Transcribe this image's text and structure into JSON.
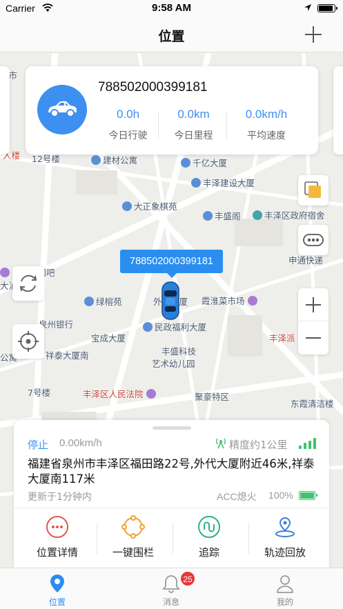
{
  "status_bar": {
    "carrier": "Carrier",
    "time": "9:58 AM"
  },
  "nav": {
    "title": "位置"
  },
  "vehicle": {
    "device_id": "788502000399181",
    "marker_label": "788502000399181",
    "stats": [
      {
        "value": "0.0h",
        "label": "今日行驶"
      },
      {
        "value": "0.0km",
        "label": "今日里程"
      },
      {
        "value": "0.0km/h",
        "label": "平均速度"
      }
    ]
  },
  "map_labels": [
    "人楼",
    "12号楼",
    "建材公寓",
    "千亿大厦",
    "丰泽建设大厦",
    "大正象棋苑",
    "丰盛阁",
    "丰泽区政府宿舍",
    "申通快递",
    "寻乐园网吧",
    "绿榕苑",
    "外代大厦",
    "霞淮菜市场",
    "泉州银行",
    "民政福利大厦",
    "宝成大厦",
    "丰泽派",
    "祥泰大厦南",
    "丰盛科技",
    "艺术幼儿园",
    "7号楼",
    "丰泽区人民法院",
    "聚豪特区",
    "东霞清洁楼",
    "大泊",
    "公寓",
    "州市"
  ],
  "status": {
    "state": "停止",
    "speed": "0.00km/h",
    "accuracy": "精度约1公里",
    "address": "福建省泉州市丰泽区福田路22号,外代大厦附近46米,祥泰大厦南117米",
    "updated": "更新于1分钟内",
    "acc": "ACC熄火",
    "battery": "100%"
  },
  "actions": [
    {
      "label": "位置详情",
      "icon": "more-dots-icon"
    },
    {
      "label": "一键围栏",
      "icon": "fence-icon"
    },
    {
      "label": "追踪",
      "icon": "track-icon"
    },
    {
      "label": "轨迹回放",
      "icon": "playback-icon"
    }
  ],
  "tabs": [
    {
      "label": "位置",
      "icon": "location-pin-icon"
    },
    {
      "label": "消息",
      "icon": "bell-icon",
      "badge": "25"
    },
    {
      "label": "我的",
      "icon": "person-icon"
    }
  ],
  "colors": {
    "accent": "#2a8ef0",
    "signal": "#3ec46d",
    "badge": "#e53935"
  }
}
